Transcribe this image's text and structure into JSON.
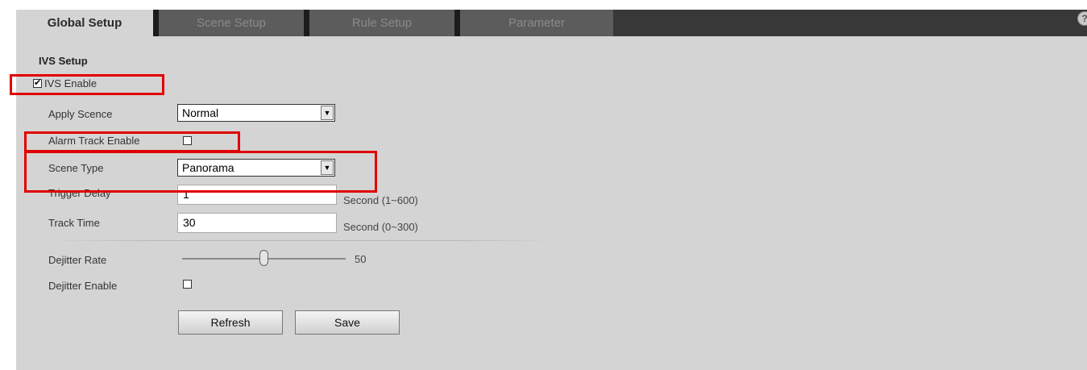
{
  "tabs": [
    {
      "label": "Global Setup",
      "active": true
    },
    {
      "label": "Scene Setup",
      "active": false
    },
    {
      "label": "Rule Setup",
      "active": false
    },
    {
      "label": "Parameter",
      "active": false
    }
  ],
  "help_icon": {
    "icon": "help-icon",
    "glyph": "?"
  },
  "section_title": "IVS Setup",
  "ivs_enable": {
    "label": "IVS Enable",
    "checked": true
  },
  "apply_scene": {
    "label": "Apply Scence",
    "value": "Normal"
  },
  "alarm_track": {
    "label": "Alarm Track Enable",
    "checked": false
  },
  "scene_type": {
    "label": "Scene Type",
    "value": "Panorama"
  },
  "trigger_delay": {
    "label": "Trigger Delay",
    "value": "1",
    "unit": "Second (1~600)"
  },
  "track_time": {
    "label": "Track Time",
    "value": "30",
    "unit": "Second (0~300)"
  },
  "dejitter_rate": {
    "label": "Dejitter Rate",
    "value": "50",
    "level": 0.5
  },
  "dejitter_enable": {
    "label": "Dejitter Enable",
    "checked": false
  },
  "buttons": {
    "refresh": "Refresh",
    "save": "Save"
  },
  "colors": {
    "highlight": "#e10000",
    "tab_bar": "#383838",
    "panel": "#d4d4d4"
  }
}
